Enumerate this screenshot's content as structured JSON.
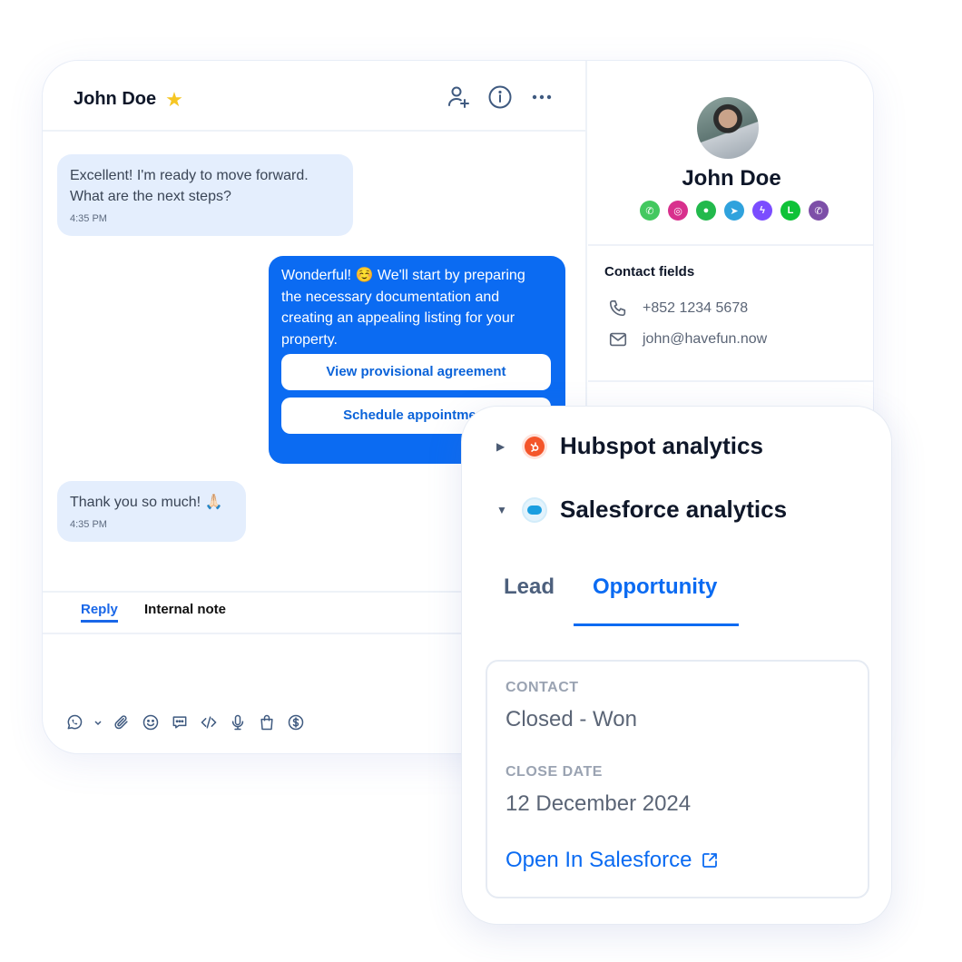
{
  "chat": {
    "contact_name": "John Doe",
    "star_icon": "star-icon",
    "header_actions": [
      {
        "icon": "add-user-icon"
      },
      {
        "icon": "info-icon"
      },
      {
        "icon": "more-icon"
      }
    ],
    "messages": [
      {
        "direction": "incoming",
        "lines": [
          "Excellent! I'm ready to move forward.",
          "What are the next steps?"
        ],
        "time": "4:35 PM"
      },
      {
        "direction": "outgoing",
        "lines": [
          "Wonderful! ☺️ We'll start by preparing",
          "the necessary documentation and",
          "creating an appealing listing for your",
          "property."
        ],
        "quick_replies": [
          "View provisional agreement",
          "Schedule appointment"
        ]
      },
      {
        "direction": "incoming",
        "lines": [
          "Thank you so much! 🙏🏻"
        ],
        "time": "4:35 PM"
      }
    ],
    "reply_tabs": {
      "reply": "Reply",
      "internal_note": "Internal note",
      "active": "reply"
    },
    "composer_tools": [
      "whatsapp-channel-icon",
      "chevron-down-icon",
      "attachment-icon",
      "emoji-icon",
      "quick-reply-icon",
      "code-icon",
      "microphone-icon",
      "shopping-bag-icon",
      "payment-icon"
    ]
  },
  "contact": {
    "name": "John Doe",
    "channels": [
      {
        "name": "whatsapp",
        "color": "#43c85f",
        "glyph": "✆"
      },
      {
        "name": "instagram",
        "color": "#d8308d",
        "glyph": "◎"
      },
      {
        "name": "wechat",
        "color": "#22b94c",
        "glyph": "●"
      },
      {
        "name": "telegram",
        "color": "#2fa2dd",
        "glyph": "➤"
      },
      {
        "name": "messenger",
        "color": "#7b4dff",
        "glyph": "ϟ"
      },
      {
        "name": "line",
        "color": "#0fc238",
        "glyph": "L"
      },
      {
        "name": "viber",
        "color": "#7d4fa8",
        "glyph": "✆"
      }
    ],
    "fields_title": "Contact fields",
    "phone": "+852 1234 5678",
    "email": "john@havefun.now"
  },
  "analytics": {
    "hubspot": {
      "label": "Hubspot analytics",
      "expanded": false,
      "color": "#f4552a"
    },
    "salesforce": {
      "label": "Salesforce analytics",
      "expanded": true,
      "color": "#1a9ee0"
    },
    "tabs": {
      "lead": "Lead",
      "opportunity": "Opportunity",
      "active": "opportunity"
    },
    "contact_label": "CONTACT",
    "contact_value": "Closed - Won",
    "close_date_label": "CLOSE DATE",
    "close_date_value": "12 December 2024",
    "open_link": "Open In Salesforce"
  },
  "colors": {
    "accent": "#0b6bf2",
    "incoming_bubble": "#e4eefd",
    "star": "#f6c623"
  }
}
